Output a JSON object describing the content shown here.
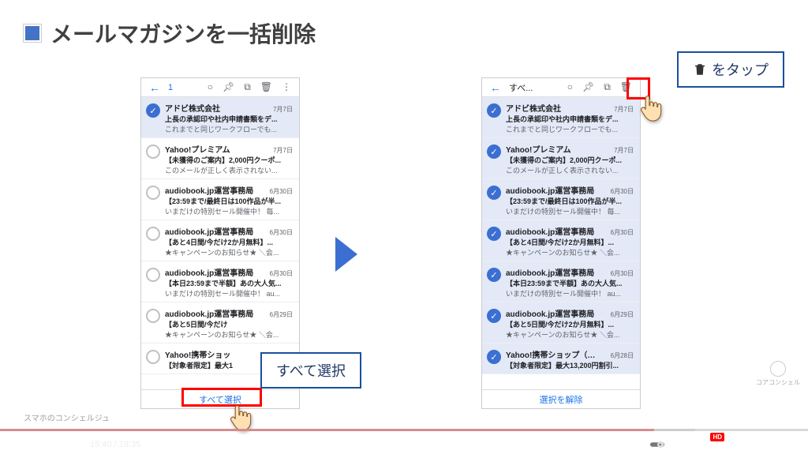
{
  "header": {
    "title": "メールマガジンを一括削除"
  },
  "callouts": {
    "select_all": "すべて選択",
    "tap_trash": "をタップ"
  },
  "phone_left": {
    "top": {
      "count": "1"
    },
    "select_all_btn": "すべて選択"
  },
  "phone_right": {
    "top": {
      "label": "すべ..."
    },
    "deselect_btn": "選択を解除"
  },
  "emails": [
    {
      "sender": "アドビ株式会社",
      "date": "7月7日",
      "subject": "上長の承認印や社内申請書類をデ...",
      "preview": "これまでと同じワークフローでも...",
      "sel_left": true
    },
    {
      "sender": "Yahoo!プレミアム",
      "date": "7月7日",
      "subject": "【未獲得のご案内】2,000円クーポ...",
      "preview": "このメールが正しく表示されない...",
      "sel_left": false
    },
    {
      "sender": "audiobook.jp運営事務局",
      "date": "6月30日",
      "subject": "【23:59まで/最終日は100作品が半...",
      "preview": "いまだけの特別セール開催中！ 毎...",
      "sel_left": false
    },
    {
      "sender": "audiobook.jp運営事務局",
      "date": "6月30日",
      "subject": "【あと4日間/今だけ2か月無料】...",
      "preview": "★キャンペーンのお知らせ★ ＼会...",
      "sel_left": false
    },
    {
      "sender": "audiobook.jp運営事務局",
      "date": "6月30日",
      "subject": "【本日23:59まで半額】あの大人気...",
      "preview": "いまだけの特別セール開催中！ au...",
      "sel_left": false
    },
    {
      "sender": "audiobook.jp運営事務局",
      "date": "6月29日",
      "subject": "【あと5日間/今だけ2か月無料】...",
      "preview": "★キャンペーンのお知らせ★ ＼会...",
      "sel_left": false
    },
    {
      "sender": "Yahoo!携帯ショップ（ソ...",
      "date": "6月28日",
      "subject": "【対象者限定】最大13,200円割引...",
      "preview": "",
      "sel_left": false
    }
  ],
  "emails_left_overrides": [
    null,
    null,
    null,
    null,
    null,
    {
      "sender": "audiobook.jp運営事務局",
      "subject": "【あと5日間/今だけ"
    },
    {
      "sender": "Yahoo!携帯ショッ",
      "subject": "【対象者限定】最大1"
    }
  ],
  "video": {
    "current": "15:40",
    "total": "19:35",
    "progress_pct": 81,
    "buffer_pct": 86,
    "hd": "HD"
  },
  "behind": "スマホのコンシェルジュ",
  "watermark": "コアコンシェル"
}
